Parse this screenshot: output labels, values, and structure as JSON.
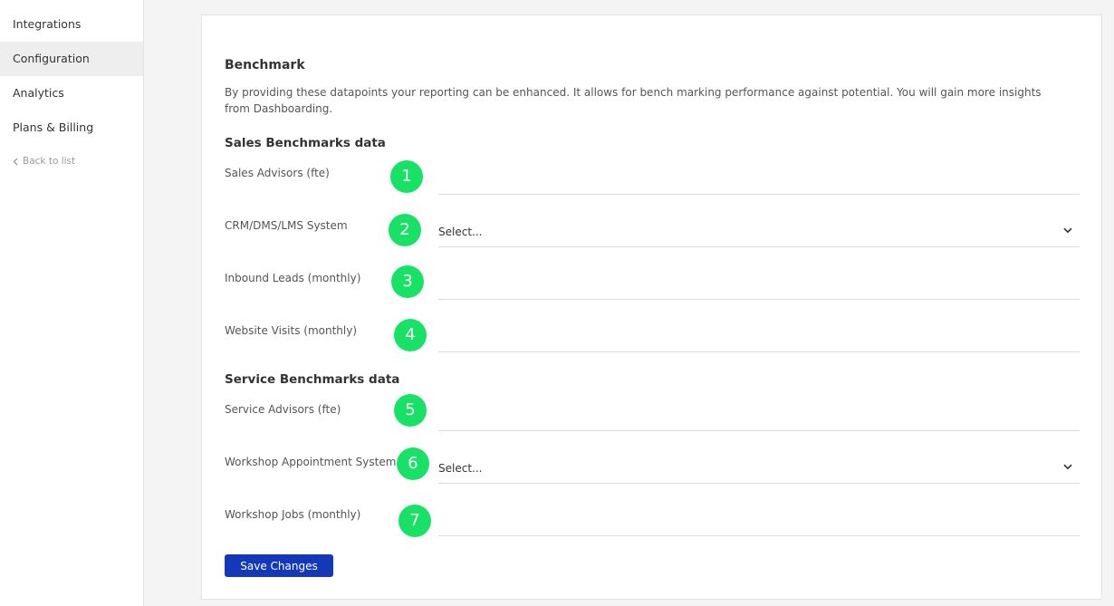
{
  "sidebar": {
    "items": [
      {
        "label": "Integrations",
        "active": false
      },
      {
        "label": "Configuration",
        "active": true
      },
      {
        "label": "Analytics",
        "active": false
      },
      {
        "label": "Plans & Billing",
        "active": false
      }
    ],
    "back_label": "Back to list",
    "back_icon": "chevron-left-icon"
  },
  "main": {
    "title": "Benchmark",
    "description": "By providing these datapoints your reporting can be enhanced. It allows for bench marking performance against potential. You will gain more insights from Dashboarding.",
    "sales_section": {
      "title": "Sales Benchmarks data",
      "fields": [
        {
          "marker": "1",
          "label": "Sales Advisors (fte)",
          "value": ""
        },
        {
          "marker": "2",
          "label": "CRM/DMS/LMS System",
          "value": "Select..."
        },
        {
          "marker": "3",
          "label": "Inbound Leads (monthly)",
          "value": ""
        },
        {
          "marker": "4",
          "label": "Website Visits (monthly)",
          "value": ""
        }
      ]
    },
    "service_section": {
      "title": "Service Benchmarks data",
      "fields": [
        {
          "marker": "5",
          "label": "Service Advisors (fte)",
          "value": ""
        },
        {
          "marker": "6",
          "label": "Workshop Appointment System",
          "value": "Select..."
        },
        {
          "marker": "7",
          "label": "Workshop Jobs (monthly)",
          "value": ""
        }
      ]
    },
    "save_label": "Save Changes"
  },
  "colors": {
    "marker": "#17e265",
    "primary_button": "#1538b8",
    "active_nav": "#eeeeee"
  }
}
